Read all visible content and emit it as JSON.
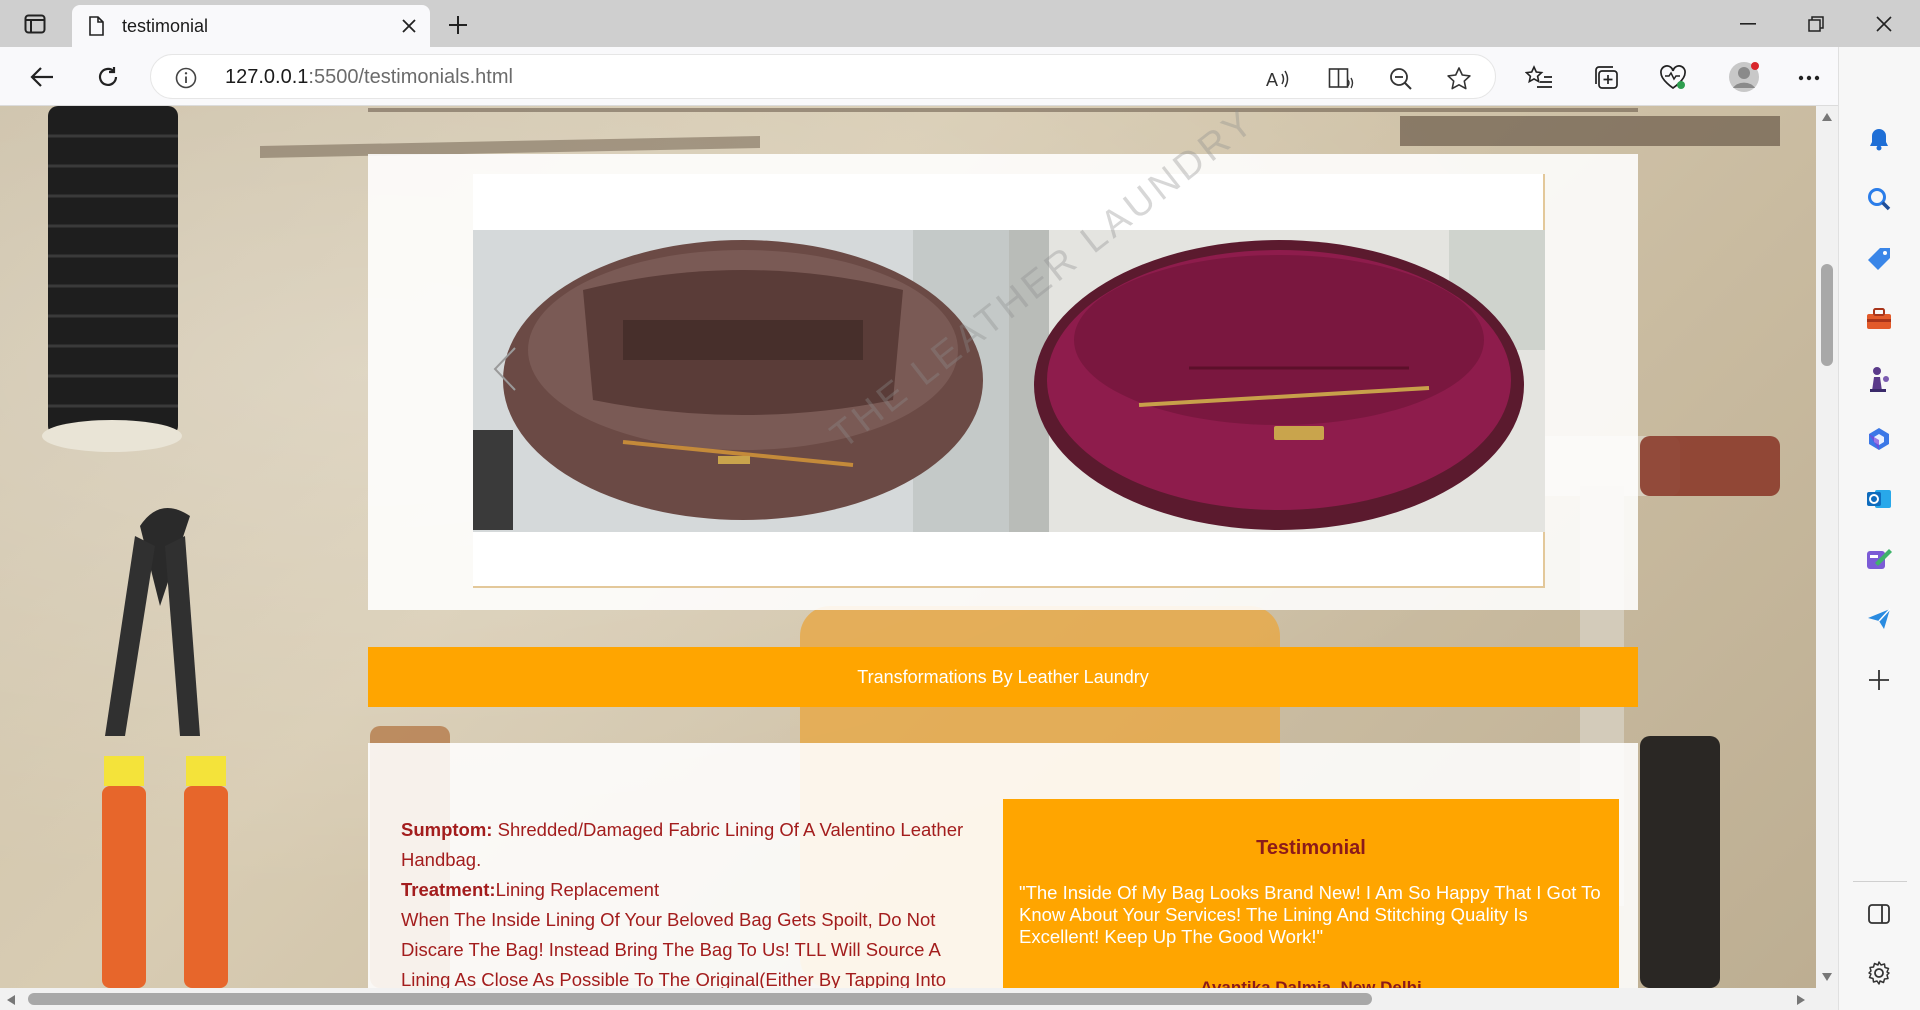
{
  "browser": {
    "tab_title": "testimonial",
    "url_host": "127.0.0.1",
    "url_rest": ":5500/testimonials.html"
  },
  "page": {
    "watermark": "THE LEATHER LAUNDRY",
    "banner": "Transformations By Leather Laundry",
    "symptom_label": "Sumptom:",
    "symptom_text": "Shredded/Damaged Fabric Lining Of A Valentino Leather Handbag.",
    "treatment_label": "Treatment:",
    "treatment_text": "Lining Replacement",
    "description": "When The Inside Lining Of Your Beloved Bag Gets Spoilt, Do Not Discare The Bag! Instead Bring The Bag To Us! TLL Will Source A Lining As Close As Possible To The Original(Either By Tapping Into",
    "testimonial": {
      "title": "Testimonial",
      "quote": "\"The Inside Of My Bag Looks Brand New! I Am So Happy That I Got To Know About Your Services! The Lining And Stitching Quality Is Excellent! Keep Up The Good Work!\"",
      "author": "Avantika Dalmia, New Delhi"
    }
  },
  "colors": {
    "accent": "#ffa500",
    "text_red": "#a31d1d",
    "title_red": "#8b1a1a"
  },
  "icons": {
    "toolbar": [
      "back-icon",
      "refresh-icon",
      "info-icon",
      "read-aloud-icon",
      "immersive-reader-icon",
      "zoom-out-icon",
      "favorite-star-icon",
      "favorites-list-icon",
      "collections-icon",
      "browser-essentials-icon",
      "profile-avatar-icon",
      "more-menu-icon",
      "bing-copilot-icon"
    ],
    "sidebar": [
      "notification-bell-icon",
      "search-icon",
      "shopping-tag-icon",
      "tools-briefcase-icon",
      "games-chess-icon",
      "microsoft365-icon",
      "outlook-icon",
      "designer-icon",
      "drop-send-icon",
      "add-icon",
      "split-screen-icon",
      "settings-gear-icon"
    ]
  }
}
